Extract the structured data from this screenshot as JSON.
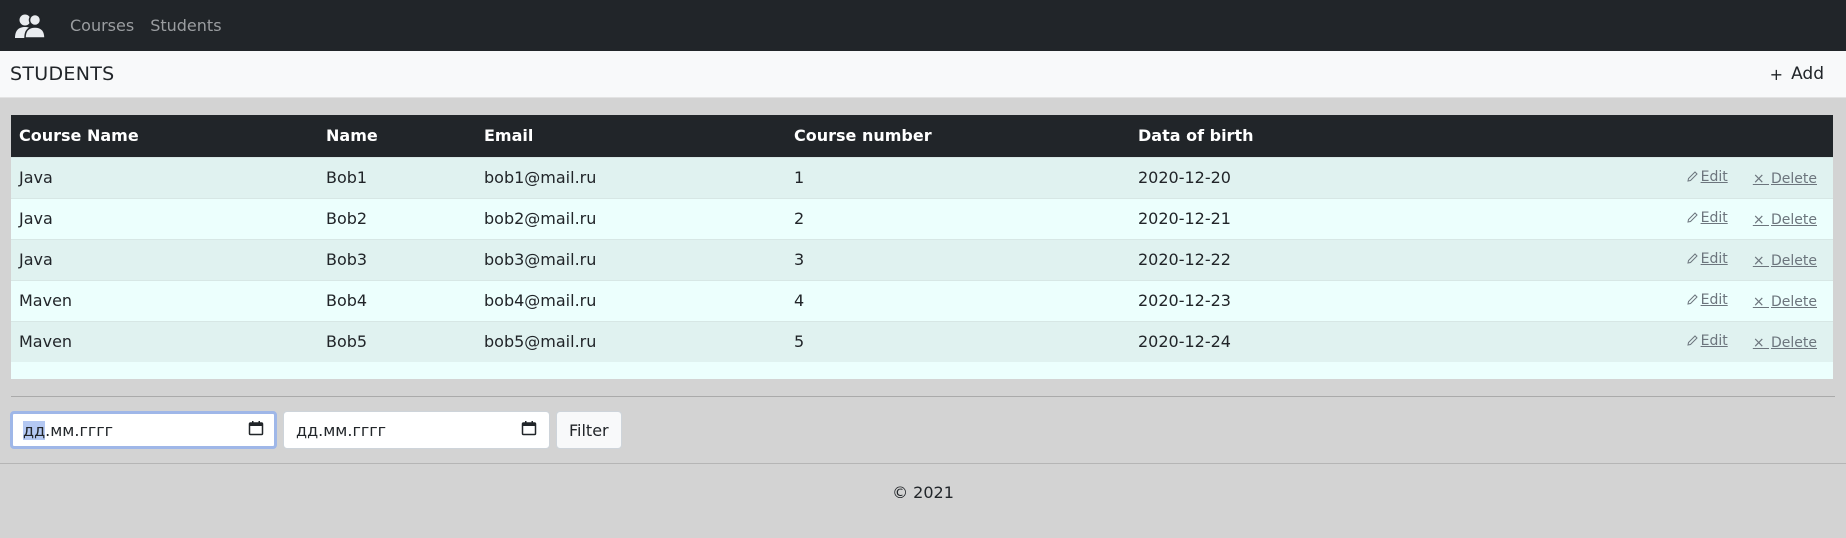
{
  "nav": {
    "logo_icon": "users-icon",
    "links": [
      {
        "label": "Courses"
      },
      {
        "label": "Students"
      }
    ]
  },
  "header": {
    "title": "STUDENTS",
    "add_label": "Add",
    "add_icon": "plus-icon"
  },
  "table": {
    "columns": [
      "Course Name",
      "Name",
      "Email",
      "Course number",
      "Data of birth"
    ],
    "rows": [
      {
        "course": "Java",
        "name": "Bob1",
        "email": "bob1@mail.ru",
        "number": "1",
        "dob": "2020-12-20"
      },
      {
        "course": "Java",
        "name": "Bob2",
        "email": "bob2@mail.ru",
        "number": "2",
        "dob": "2020-12-21"
      },
      {
        "course": "Java",
        "name": "Bob3",
        "email": "bob3@mail.ru",
        "number": "3",
        "dob": "2020-12-22"
      },
      {
        "course": "Maven",
        "name": "Bob4",
        "email": "bob4@mail.ru",
        "number": "4",
        "dob": "2020-12-23"
      },
      {
        "course": "Maven",
        "name": "Bob5",
        "email": "bob5@mail.ru",
        "number": "5",
        "dob": "2020-12-24"
      }
    ],
    "edit_label": "Edit",
    "delete_label": "Delete"
  },
  "filter": {
    "from_placeholder_sel": "дд",
    "from_placeholder_rest": ".мм.гггг",
    "to_placeholder": "дд.мм.гггг",
    "button_label": "Filter"
  },
  "footer": {
    "text": "© 2021"
  },
  "colors": {
    "navbar_bg": "#212529",
    "page_bg": "#d3d3d3",
    "table_header_bg": "#212529",
    "row_odd": "#e0f2f0",
    "row_even": "#ecfffd"
  }
}
